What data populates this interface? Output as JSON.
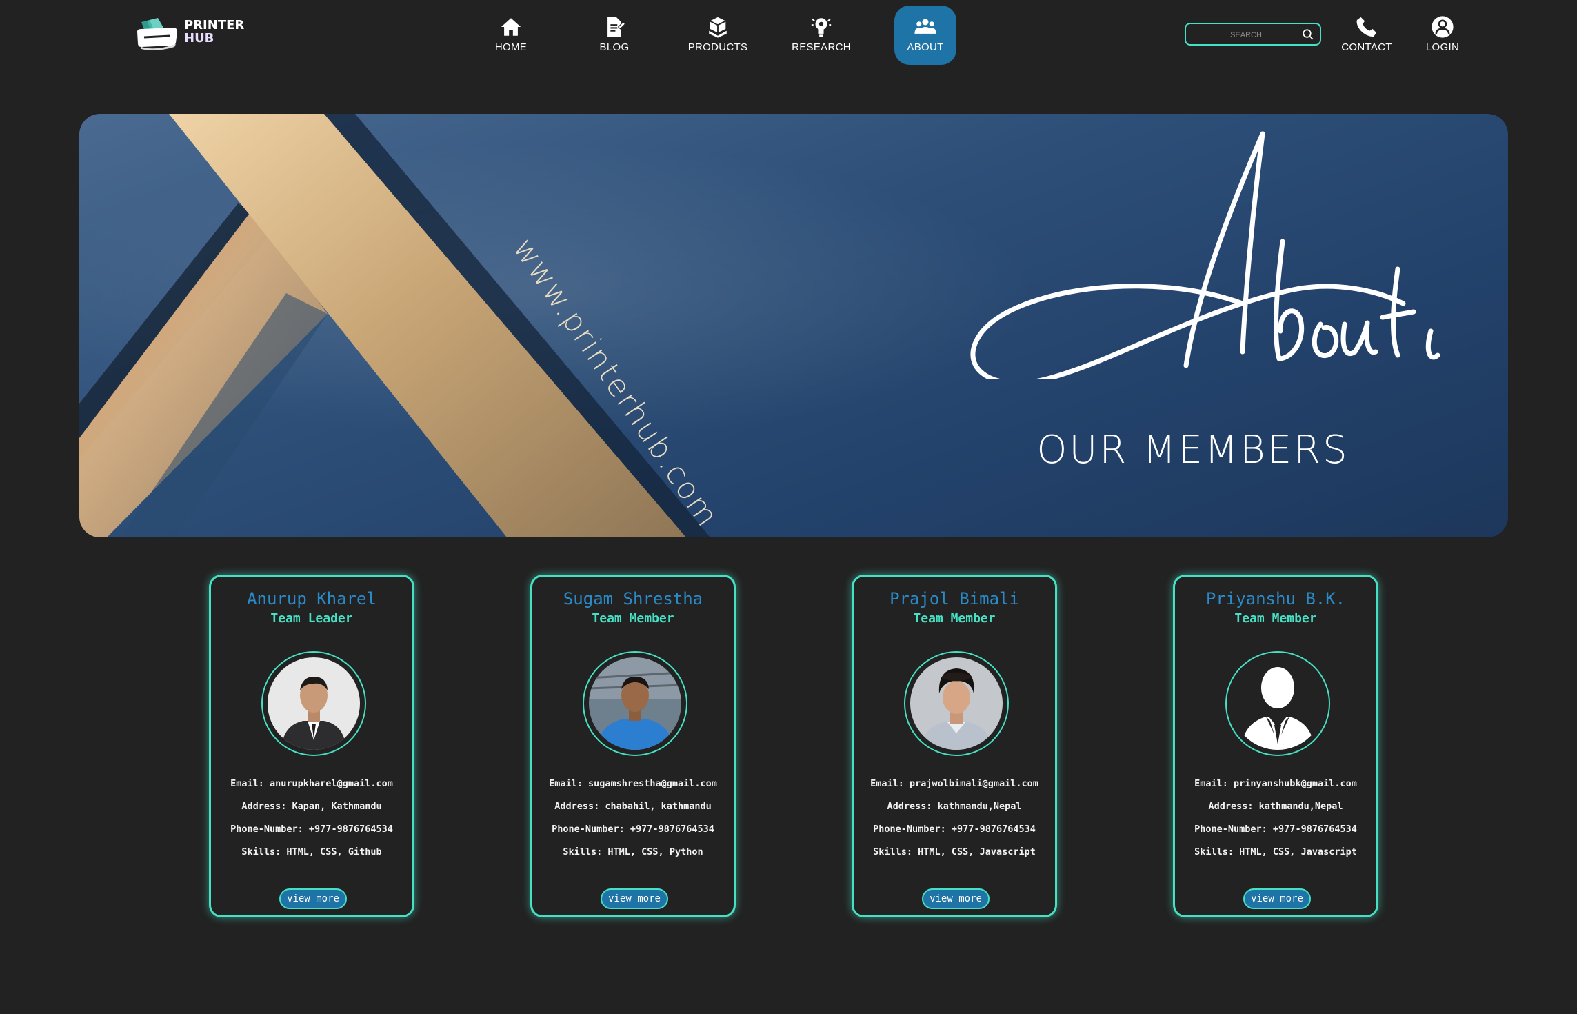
{
  "brand": {
    "line1": "PRINTER",
    "line2": "HUB",
    "logo_icon": "printer-logo-icon"
  },
  "nav": {
    "items": [
      {
        "label": "HOME",
        "icon": "home-icon"
      },
      {
        "label": "BLOG",
        "icon": "blog-icon"
      },
      {
        "label": "PRODUCTS",
        "icon": "products-icon"
      },
      {
        "label": "RESEARCH",
        "icon": "research-icon"
      },
      {
        "label": "ABOUT",
        "icon": "about-icon",
        "active": true
      }
    ],
    "search_placeholder": "SEARCH",
    "contact_label": "CONTACT",
    "login_label": "LOGIN"
  },
  "hero": {
    "url_text": "www.printerhub.com",
    "script_title": "About us",
    "subtitle": "OUR MEMBERS"
  },
  "members": [
    {
      "name": "Anurup Kharel",
      "role": "Team Leader",
      "email": "Email: anurupkharel@gmail.com",
      "address": "Address: Kapan, Kathmandu",
      "phone": "Phone-Number: +977-9876764534",
      "skills": "Skills: HTML, CSS, Github",
      "button": "view more"
    },
    {
      "name": "Sugam Shrestha",
      "role": "Team Member",
      "email": "Email: sugamshrestha@gmail.com",
      "address": "Address: chabahil, kathmandu",
      "phone": "Phone-Number: +977-9876764534",
      "skills": "Skills: HTML, CSS, Python",
      "button": "view more"
    },
    {
      "name": "Prajol Bimali",
      "role": "Team Member",
      "email": "Email: prajwolbimali@gmail.com",
      "address": "Address: kathmandu,Nepal",
      "phone": "Phone-Number: +977-9876764534",
      "skills": "Skills: HTML, CSS, Javascript",
      "button": "view more"
    },
    {
      "name": "Priyanshu B.K.",
      "role": "Team Member",
      "email": "Email: prinyanshubk@gmail.com",
      "address": "Address: kathmandu,Nepal",
      "phone": "Phone-Number: +977-9876764534",
      "skills": "Skills: HTML, CSS, Javascript",
      "button": "view more"
    }
  ],
  "colors": {
    "accent": "#46e0c4",
    "active_nav": "#1e74a6",
    "name_blue": "#2a8bc9",
    "background": "#222222"
  }
}
